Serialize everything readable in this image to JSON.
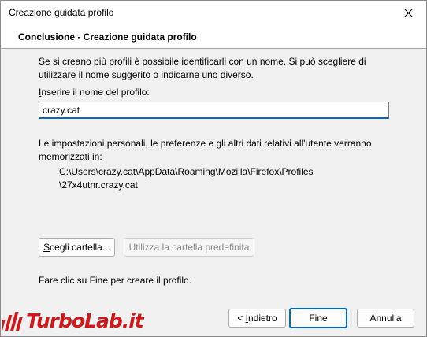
{
  "window": {
    "title": "Creazione guidata profilo"
  },
  "header": {
    "title": "Conclusione - Creazione guidata profilo"
  },
  "intro": {
    "line1": "Se si creano più profili è possibile identificarli con un nome. Si può scegliere di",
    "line2": "utilizzare il nome suggerito o indicarne uno diverso."
  },
  "name_field": {
    "label_mnemonic": "I",
    "label_rest": "nserire il nome del profilo:",
    "value": "crazy.cat"
  },
  "storage": {
    "line1": "Le impostazioni personali, le preferenze e gli altri dati relativi all'utente verranno",
    "line2": "memorizzati in:",
    "path_line1": "C:\\Users\\crazy.cat\\AppData\\Roaming\\Mozilla\\Firefox\\Profiles",
    "path_line2": "\\27x4utnr.crazy.cat"
  },
  "buttons": {
    "choose_folder_mnemonic": "S",
    "choose_folder_rest": "cegli cartella...",
    "default_folder": "Utilizza la cartella predefinita",
    "back_prefix": "< ",
    "back_mnemonic": "I",
    "back_rest": "ndietro",
    "finish": "Fine",
    "cancel": "Annulla"
  },
  "finish_hint": "Fare clic su Fine per creare il profilo.",
  "watermark": {
    "text": "TurboLab.it"
  },
  "colors": {
    "accent": "#0067c0",
    "watermark": "#d01818"
  },
  "icons": {
    "close": "close-icon",
    "watermark": "turbolab-logo-icon"
  }
}
